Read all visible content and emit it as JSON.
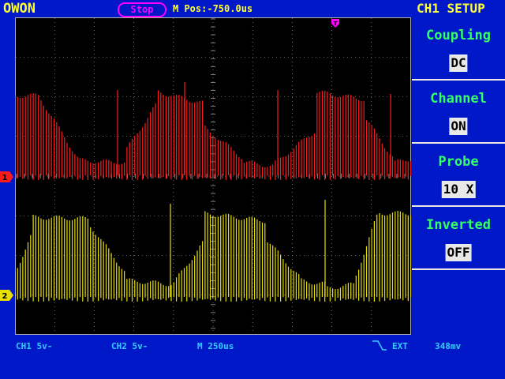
{
  "header": {
    "brand": "OWON",
    "run_status": "Stop",
    "main_position": "M Pos:-750.0us",
    "menu_title": "CH1 SETUP"
  },
  "menu": {
    "items": [
      {
        "label": "Coupling",
        "value": "DC"
      },
      {
        "label": "Channel",
        "value": "ON"
      },
      {
        "label": "Probe",
        "value": "10 X"
      },
      {
        "label": "Inverted",
        "value": "OFF"
      }
    ]
  },
  "markers": {
    "ch1": "1",
    "ch2": "2"
  },
  "status": {
    "ch1_scale": "CH1  5v-",
    "ch2_scale": "CH2  5v-",
    "timebase": "M 250us",
    "trigger_source": "EXT",
    "trigger_level": "348mv"
  },
  "colors": {
    "background": "#0018c8",
    "screen": "#000000",
    "ch1": "#ff1a1a",
    "ch2": "#e8e000",
    "grid": "#b0b0b0",
    "trigger": "#ff00ff",
    "accent": "#ffff33",
    "menu_label": "#33ff66",
    "status": "#33ccff"
  }
}
